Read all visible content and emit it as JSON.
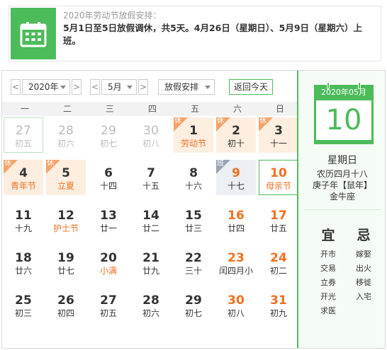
{
  "notice": {
    "icon": "calendar-icon",
    "title": "2020年劳动节放假安排：",
    "text": "5月1日至5日放假调休，共5天。4月26日（星期日）、5月9日（星期六）上班。"
  },
  "toolbar": {
    "prev_year": "<",
    "year": "2020年",
    "next_year": ">",
    "prev_month": "<",
    "month": "5月",
    "next_month": ">",
    "holiday_select": "放假安排",
    "today_button": "返回今天"
  },
  "weekdays": [
    "一",
    "二",
    "三",
    "四",
    "五",
    "六",
    "日"
  ],
  "tags": {
    "rest": "休",
    "work": "班"
  },
  "colors": {
    "accent": "#4cbb59",
    "festival": "#f26f20",
    "holiday_bg": "#fdeee0",
    "workday_bg": "#eceff4"
  },
  "days": [
    {
      "d": "27",
      "l": "初五",
      "t": "other"
    },
    {
      "d": "28",
      "l": "初六",
      "t": "other"
    },
    {
      "d": "29",
      "l": "初七",
      "t": "other"
    },
    {
      "d": "30",
      "l": "初八",
      "t": "other"
    },
    {
      "d": "1",
      "l": "劳动节",
      "t": "holiday festival",
      "tag": "rest"
    },
    {
      "d": "2",
      "l": "初十",
      "t": "holiday weekend",
      "tag": "rest"
    },
    {
      "d": "3",
      "l": "十一",
      "t": "holiday weekend",
      "tag": "rest"
    },
    {
      "d": "4",
      "l": "青年节",
      "t": "holiday festival",
      "tag": "rest"
    },
    {
      "d": "5",
      "l": "立夏",
      "t": "holiday festival",
      "tag": "rest"
    },
    {
      "d": "6",
      "l": "十四",
      "t": ""
    },
    {
      "d": "7",
      "l": "十五",
      "t": ""
    },
    {
      "d": "8",
      "l": "十六",
      "t": ""
    },
    {
      "d": "9",
      "l": "十七",
      "t": "workday",
      "tag": "work"
    },
    {
      "d": "10",
      "l": "母亲节",
      "t": "today weekend festival"
    },
    {
      "d": "11",
      "l": "十九",
      "t": ""
    },
    {
      "d": "12",
      "l": "护士节",
      "t": "festival"
    },
    {
      "d": "13",
      "l": "廿一",
      "t": ""
    },
    {
      "d": "14",
      "l": "廿二",
      "t": ""
    },
    {
      "d": "15",
      "l": "廿三",
      "t": ""
    },
    {
      "d": "16",
      "l": "廿四",
      "t": "weekend"
    },
    {
      "d": "17",
      "l": "廿五",
      "t": "weekend"
    },
    {
      "d": "18",
      "l": "廿六",
      "t": ""
    },
    {
      "d": "19",
      "l": "廿七",
      "t": ""
    },
    {
      "d": "20",
      "l": "小满",
      "t": "festival"
    },
    {
      "d": "21",
      "l": "廿九",
      "t": ""
    },
    {
      "d": "22",
      "l": "三十",
      "t": ""
    },
    {
      "d": "23",
      "l": "闰四月小",
      "t": "weekend"
    },
    {
      "d": "24",
      "l": "初二",
      "t": "weekend"
    },
    {
      "d": "25",
      "l": "初三",
      "t": ""
    },
    {
      "d": "26",
      "l": "初四",
      "t": ""
    },
    {
      "d": "27",
      "l": "初五",
      "t": ""
    },
    {
      "d": "28",
      "l": "初六",
      "t": ""
    },
    {
      "d": "29",
      "l": "初七",
      "t": ""
    },
    {
      "d": "30",
      "l": "初八",
      "t": "weekend"
    },
    {
      "d": "31",
      "l": "初九",
      "t": "weekend"
    }
  ],
  "side": {
    "month_header": "2020年05月",
    "day": "10",
    "weekday": "星期日",
    "lunar": "农历四月十八",
    "ganzhi": "庚子年【鼠年】",
    "constellation": "金牛座",
    "yi_title": "宜",
    "ji_title": "忌",
    "yi": [
      "开市",
      "交易",
      "立券",
      "开光",
      "求医"
    ],
    "ji": [
      "嫁娶",
      "出火",
      "移徙",
      "入宅"
    ]
  }
}
